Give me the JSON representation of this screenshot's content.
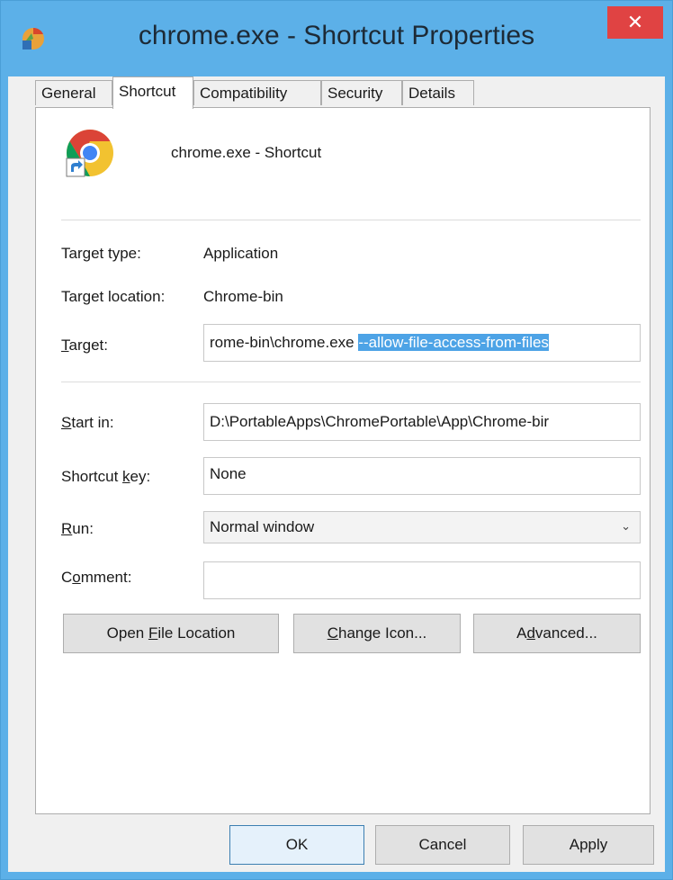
{
  "window": {
    "title": "chrome.exe - Shortcut Properties",
    "close_glyph": "✕"
  },
  "tabs": [
    {
      "label": "General"
    },
    {
      "label": "Shortcut",
      "active": true
    },
    {
      "label": "Compatibility"
    },
    {
      "label": "Security"
    },
    {
      "label": "Details"
    }
  ],
  "shortcut_name": "chrome.exe - Shortcut",
  "target_type": {
    "label": "Target type:",
    "value": "Application"
  },
  "target_location": {
    "label": "Target location:",
    "value": "Chrome-bin"
  },
  "target": {
    "label_pre": "",
    "label_accel": "T",
    "label_post": "arget:",
    "value_plain": "rome-bin\\chrome.exe ",
    "value_selected": "--allow-file-access-from-files"
  },
  "start_in": {
    "label_accel": "S",
    "label_post": "tart in:",
    "value": "D:\\PortableApps\\ChromePortable\\App\\Chrome-bir"
  },
  "shortcut_key": {
    "label_pre": "Shortcut ",
    "label_accel": "k",
    "label_post": "ey:",
    "value": "None"
  },
  "run": {
    "label_accel": "R",
    "label_post": "un:",
    "value": "Normal window",
    "chevron": "⌄"
  },
  "comment": {
    "label_pre": "C",
    "label_accel": "o",
    "label_post": "mment:",
    "value": ""
  },
  "actions": {
    "open_file_location": {
      "pre": "Open ",
      "accel": "F",
      "post": "ile Location"
    },
    "change_icon": {
      "pre": "",
      "accel": "C",
      "post": "hange Icon..."
    },
    "advanced": {
      "pre": "A",
      "accel": "d",
      "post": "vanced..."
    }
  },
  "footer": {
    "ok": "OK",
    "cancel": "Cancel",
    "apply": "Apply"
  },
  "colors": {
    "titlebar": "#5cb0e8",
    "close": "#e04343",
    "selection": "#4da3e6"
  }
}
